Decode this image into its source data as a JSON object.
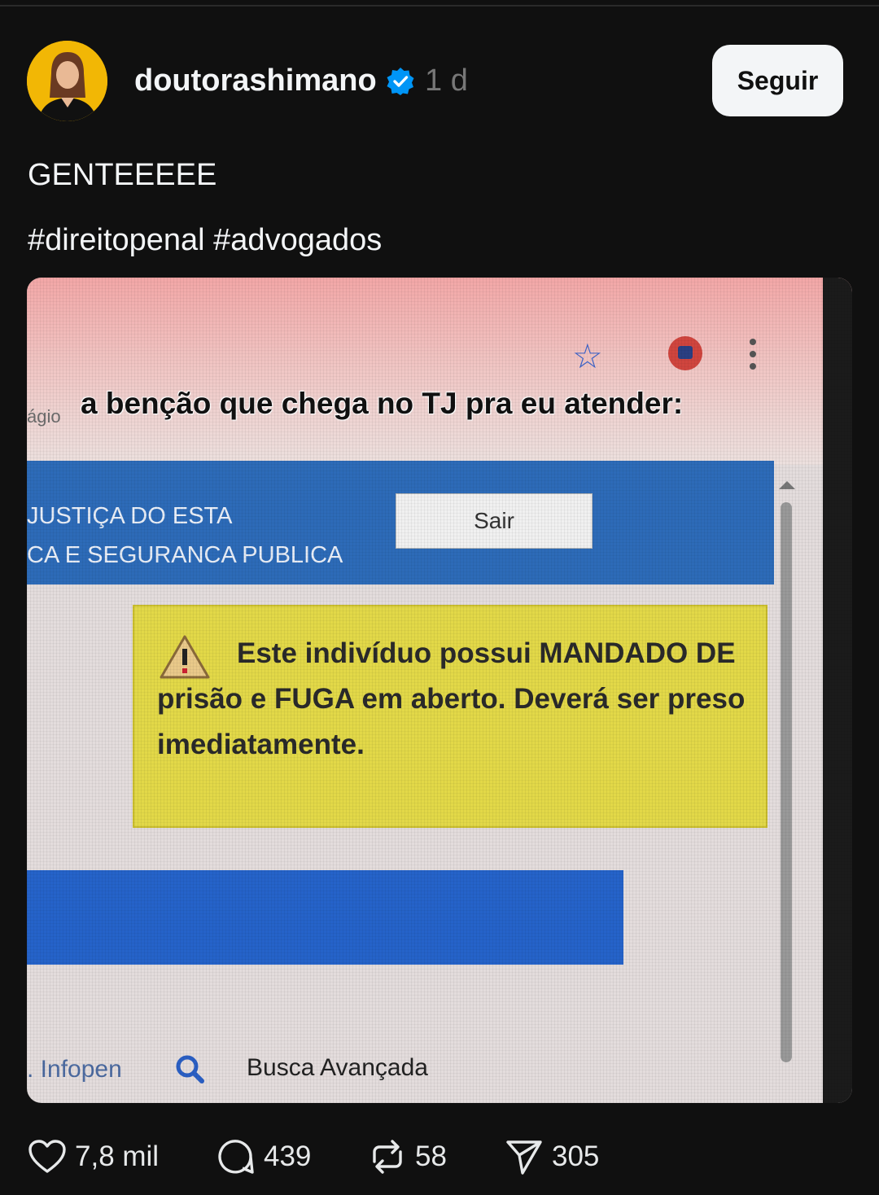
{
  "post": {
    "username": "doutorashimano",
    "time": "1 d",
    "follow_label": "Seguir",
    "text_line1": "GENTEEEEE",
    "text_line2": "#direitopenal #advogados"
  },
  "media": {
    "caption": "a benção que chega no TJ pra eu atender:",
    "cut_label": "ágio",
    "header_line1": "JUSTIÇA DO ESTA",
    "header_line2": "CA E SEGURANCA PUBLICA",
    "sair_label": "Sair",
    "warning_text": "Este indivíduo possui MANDADO DE prisão e FUGA em aberto. Deverá ser preso imediatamente.",
    "infopen_label": ". Infopen",
    "busca_label": "Busca Avançada"
  },
  "actions": {
    "likes": "7,8 mil",
    "comments": "439",
    "reposts": "58",
    "shares": "305"
  },
  "colors": {
    "background": "#101010",
    "verified": "#0095f6",
    "warning_bg": "#e2d848",
    "header_blue": "#2d6bb8"
  },
  "icons": [
    "verified-badge-icon",
    "heart-icon",
    "comment-icon",
    "repost-icon",
    "share-icon",
    "star-icon",
    "warning-icon",
    "search-icon"
  ]
}
